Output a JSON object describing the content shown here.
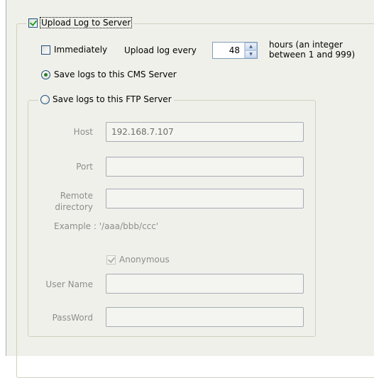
{
  "upload": {
    "checkbox_label": "Upload Log to Server",
    "checked": true,
    "immediately_label": "Immediately",
    "immediately_checked": false,
    "every_label": "Upload log every",
    "every_value": "48",
    "hours_hint": "hours (an integer between 1 and 999)"
  },
  "cms": {
    "label": "Save logs to this CMS Server",
    "selected": true
  },
  "ftp": {
    "label": "Save logs to this FTP Server",
    "selected": false,
    "host_label": "Host",
    "host_value": "192.168.7.107",
    "port_label": "Port",
    "port_value": "",
    "remote_label": "Remote directory",
    "remote_value": "",
    "example_text": "Example : '/aaa/bbb/ccc'",
    "anonymous_label": "Anonymous",
    "anonymous_checked": true,
    "username_label": "User Name",
    "username_value": "",
    "password_label": "PassWord",
    "password_value": ""
  },
  "colors": {
    "panel": "#f0f0ea",
    "disabled_text": "#8d8d8d",
    "check_green": "#21a121"
  },
  "icons": {
    "spin_up": "triangle-up",
    "spin_down": "triangle-down"
  }
}
